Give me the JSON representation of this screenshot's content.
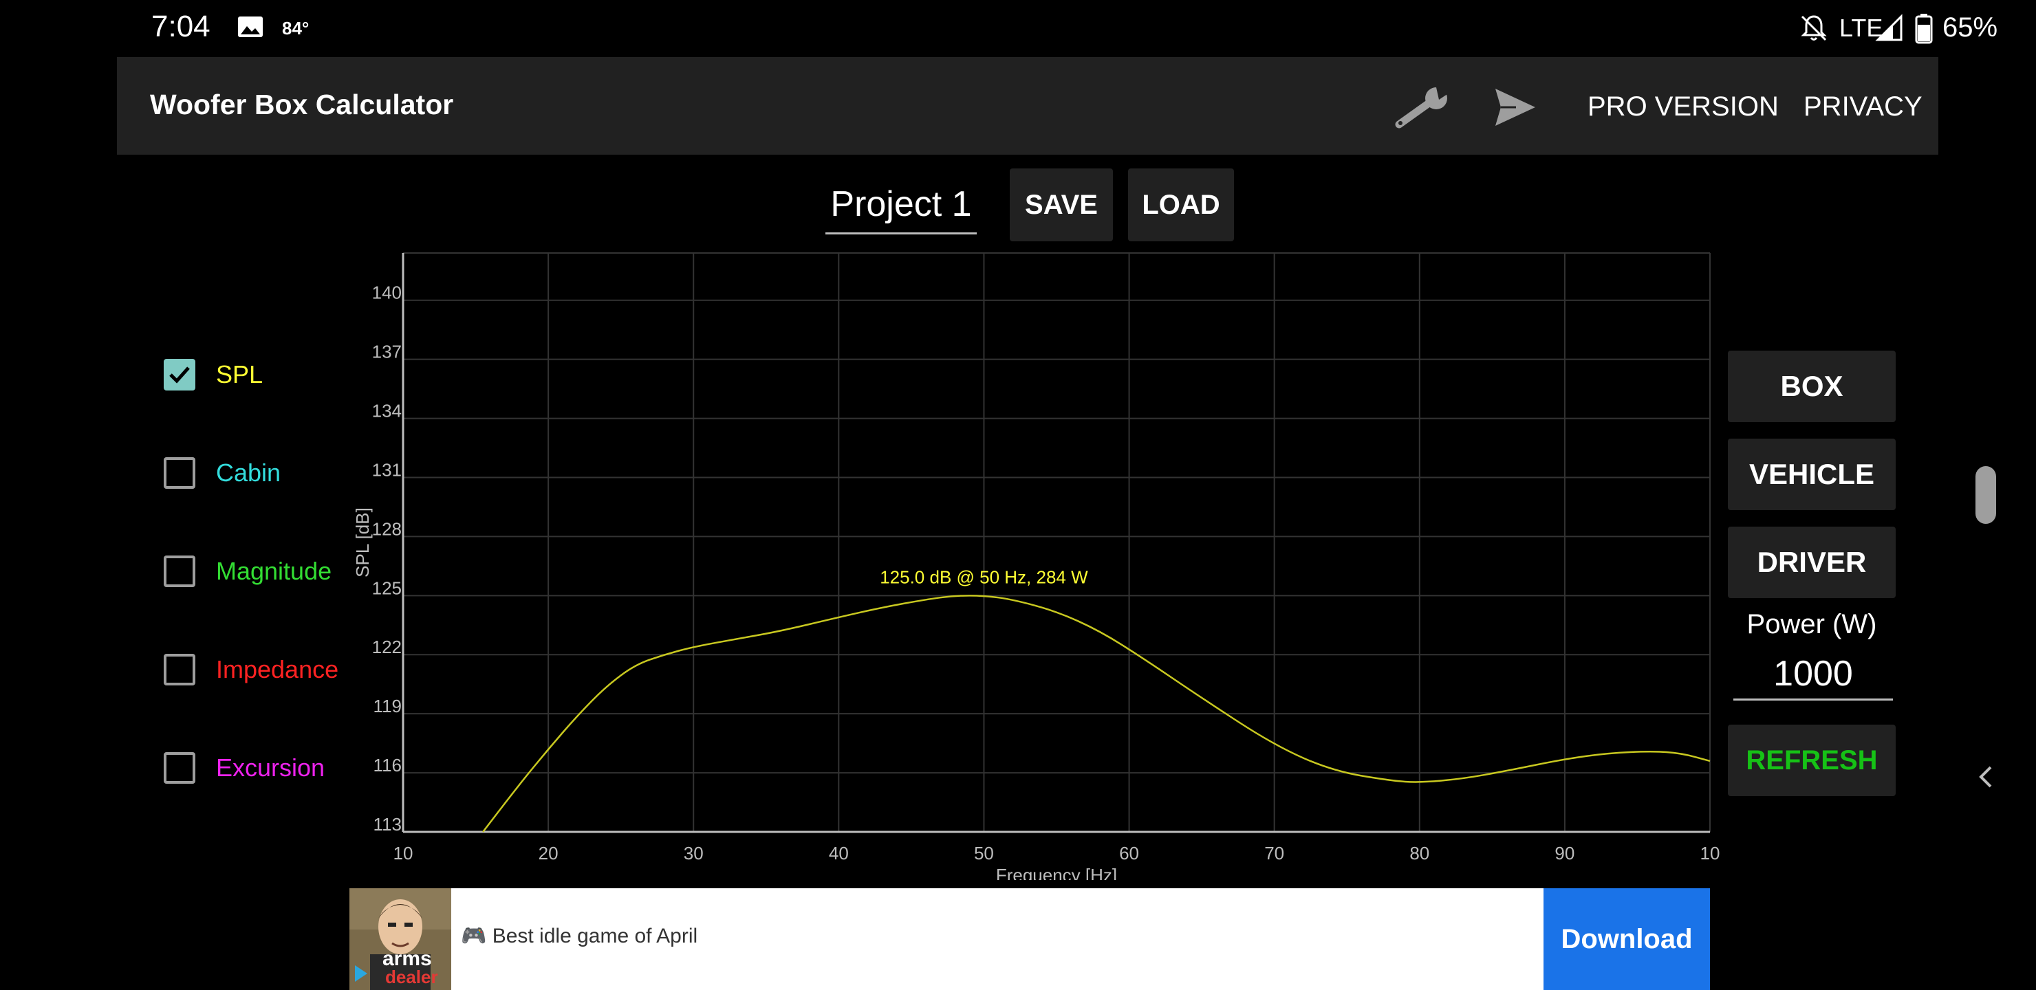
{
  "status_bar": {
    "time": "7:04",
    "temperature": "84°",
    "network": "LTE",
    "battery_pct": "65%",
    "icons": [
      "image-icon",
      "bell-off-icon",
      "signal-icon",
      "battery-icon"
    ]
  },
  "app_bar": {
    "title": "Woofer Box Calculator",
    "pro_label": "PRO VERSION",
    "privacy_label": "PRIVACY",
    "icons": [
      "wrench-icon",
      "send-icon"
    ]
  },
  "project": {
    "name": "Project 1",
    "save_label": "SAVE",
    "load_label": "LOAD"
  },
  "toggles": [
    {
      "label": "SPL",
      "checked": true,
      "color": "#ffff33"
    },
    {
      "label": "Cabin",
      "checked": false,
      "color": "#33dddd"
    },
    {
      "label": "Magnitude",
      "checked": false,
      "color": "#33dd33"
    },
    {
      "label": "Impedance",
      "checked": false,
      "color": "#ff2222"
    },
    {
      "label": "Excursion",
      "checked": false,
      "color": "#ee22ee"
    }
  ],
  "chart_data": {
    "type": "line",
    "xlabel": "Frequency [Hz]",
    "ylabel": "SPL [dB]",
    "xlim": [
      10,
      100
    ],
    "ylim": [
      113,
      140
    ],
    "x_ticks": [
      10,
      20,
      30,
      40,
      50,
      60,
      70,
      80,
      90,
      100
    ],
    "x_tick_labels": [
      "10",
      "20",
      "30",
      "40",
      "50",
      "60",
      "70",
      "80",
      "90",
      "10"
    ],
    "y_ticks": [
      113,
      116,
      119,
      122,
      125,
      128,
      131,
      134,
      137,
      140
    ],
    "grid": true,
    "series": [
      {
        "color": "#c8c820",
        "x": [
          15.5,
          18,
          20,
          22,
          24,
          26,
          28,
          30,
          33,
          36,
          40,
          43,
          46,
          48,
          50,
          52,
          55,
          58,
          61,
          65,
          70,
          74,
          78,
          80,
          83,
          86,
          90,
          93,
          96,
          98,
          100
        ],
        "y": [
          113.0,
          115.4,
          117.2,
          118.9,
          120.4,
          121.5,
          122.0,
          122.4,
          122.8,
          123.2,
          123.9,
          124.4,
          124.8,
          125.0,
          125.0,
          124.8,
          124.2,
          123.2,
          121.8,
          119.8,
          117.4,
          116.1,
          115.6,
          115.5,
          115.7,
          116.1,
          116.7,
          117.0,
          117.1,
          117.0,
          116.6
        ]
      }
    ],
    "annotation": {
      "text": "125.0 dB @ 50 Hz, 284 W",
      "x": 50,
      "y": 125,
      "color": "#ffff33"
    }
  },
  "side_panel": {
    "box_label": "BOX",
    "vehicle_label": "VEHICLE",
    "driver_label": "DRIVER",
    "power_label": "Power (W)",
    "power_value": "1000",
    "refresh_label": "REFRESH",
    "refresh_color": "#16c216"
  },
  "ad": {
    "brand_line1": "arms",
    "brand_line2": "dealer",
    "text": "🎮 Best idle game of April",
    "download_label": "Download"
  }
}
